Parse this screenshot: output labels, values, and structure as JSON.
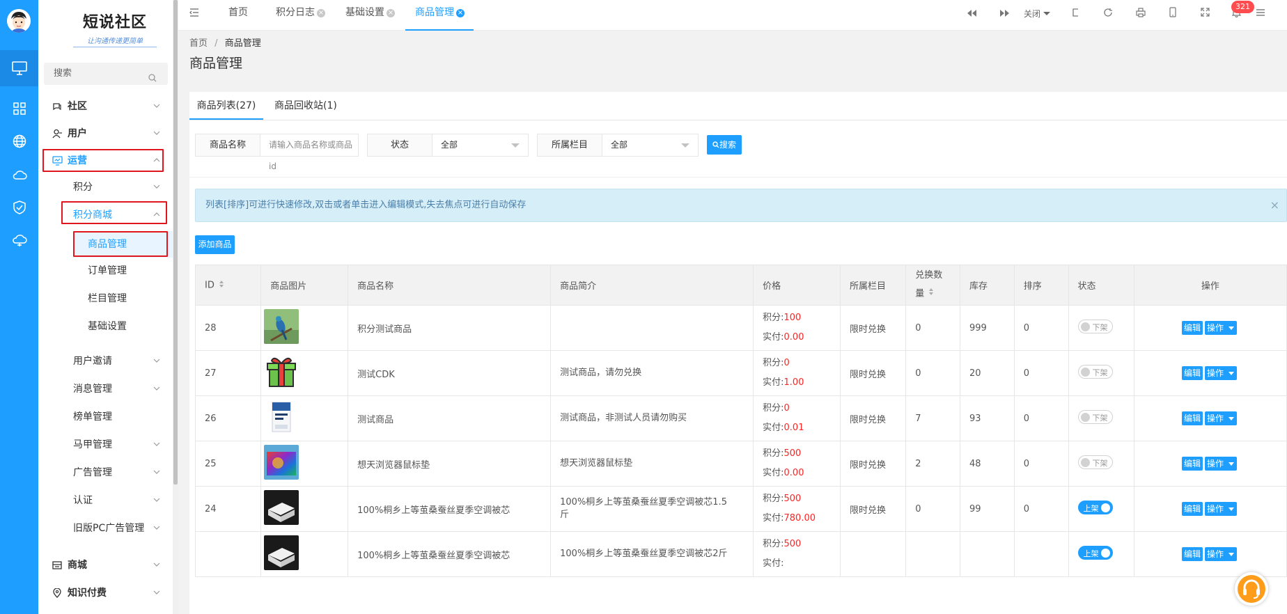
{
  "rail": {
    "items": [
      "monitor-icon",
      "grid-icon",
      "globe-icon",
      "cloud-icon",
      "shield-check-icon",
      "cloud-sync-icon"
    ],
    "accent": "#1E9FFF"
  },
  "sidebar": {
    "logo_title": "短说社区",
    "logo_slogan": "让沟通传递更简单",
    "search_placeholder": "搜索",
    "menu": [
      {
        "label": "社区"
      },
      {
        "label": "用户"
      },
      {
        "label": "运营"
      },
      {
        "label": "积分"
      },
      {
        "label": "积分商城"
      },
      {
        "label": "商品管理"
      },
      {
        "label": "订单管理"
      },
      {
        "label": "栏目管理"
      },
      {
        "label": "基础设置"
      },
      {
        "label": "用户邀请"
      },
      {
        "label": "消息管理"
      },
      {
        "label": "榜单管理"
      },
      {
        "label": "马甲管理"
      },
      {
        "label": "广告管理"
      },
      {
        "label": "认证"
      },
      {
        "label": "旧版PC广告管理"
      },
      {
        "label": "商城"
      },
      {
        "label": "知识付费"
      }
    ]
  },
  "topbar": {
    "tabs": [
      {
        "label": "首页"
      },
      {
        "label": "积分日志"
      },
      {
        "label": "基础设置"
      },
      {
        "label": "商品管理"
      }
    ],
    "close_label": "关闭",
    "notif_count": "321"
  },
  "page": {
    "breadcrumb_home": "首页",
    "breadcrumb_sep": "/",
    "breadcrumb_current": "商品管理",
    "title": "商品管理",
    "tabs": [
      {
        "label": "商品列表(27)"
      },
      {
        "label": "商品回收站(1)"
      }
    ]
  },
  "filters": {
    "name_label": "商品名称",
    "name_placeholder": "请输入商品名称或商品id",
    "status_label": "状态",
    "status_value": "全部",
    "column_label": "所属栏目",
    "column_value": "全部",
    "search_button": "搜索"
  },
  "tip": {
    "text": "列表[排序]可进行快速修改,双击或者单击进入编辑模式,失去焦点可进行自动保存",
    "close": "×"
  },
  "add_button": "添加商品",
  "table": {
    "headers": {
      "id": "ID",
      "image": "商品图片",
      "name": "商品名称",
      "desc": "商品简介",
      "price": "价格",
      "column": "所属栏目",
      "exchange_1": "兑换数",
      "exchange_2": "量",
      "stock": "库存",
      "sort": "排序",
      "status": "状态",
      "ops": "操作"
    },
    "price_points_label": "积分:",
    "price_real_label": "实付:",
    "edit_label": "编辑",
    "op_label": "操作",
    "rows": [
      {
        "id": "28",
        "name": "积分测试商品",
        "desc": "",
        "points": "100",
        "real": "0.00",
        "column": "限时兑换",
        "exchange": "0",
        "stock": "999",
        "sort": "0",
        "status": "下架",
        "on": false,
        "img": "bird"
      },
      {
        "id": "27",
        "name": "测试CDK",
        "desc": "测试商品，请勿兑换",
        "points": "0",
        "real": "1.00",
        "column": "限时兑换",
        "exchange": "0",
        "stock": "20",
        "sort": "0",
        "status": "下架",
        "on": false,
        "img": "gift"
      },
      {
        "id": "26",
        "name": "测试商品",
        "desc": "测试商品，非测试人员请勿购买",
        "points": "0",
        "real": "0.01",
        "column": "限时兑换",
        "exchange": "7",
        "stock": "93",
        "sort": "0",
        "status": "下架",
        "on": false,
        "img": "book"
      },
      {
        "id": "25",
        "name": "想天浏览器鼠标垫",
        "desc": "想天浏览器鼠标垫",
        "points": "500",
        "real": "0.00",
        "column": "限时兑换",
        "exchange": "2",
        "stock": "48",
        "sort": "0",
        "status": "下架",
        "on": false,
        "img": "pad"
      },
      {
        "id": "24",
        "name": "100%桐乡上等茧桑蚕丝夏季空调被芯",
        "desc_1": "100%桐乡上等茧桑蚕丝夏季空调被芯1.5",
        "desc_2": "斤",
        "points": "500",
        "real": "780.00",
        "column": "限时兑换",
        "exchange": "0",
        "stock": "99",
        "sort": "0",
        "status": "上架",
        "on": true,
        "img": "quilt"
      },
      {
        "id": "",
        "name": "100%桐乡上等茧桑蚕丝夏季空调被芯",
        "desc": "100%桐乡上等茧桑蚕丝夏季空调被芯2斤",
        "points": "500",
        "real": "",
        "column": "",
        "exchange": "",
        "stock": "",
        "sort": "",
        "status": "上架",
        "on": true,
        "img": "quilt"
      }
    ]
  },
  "support_icon": "headset-icon"
}
